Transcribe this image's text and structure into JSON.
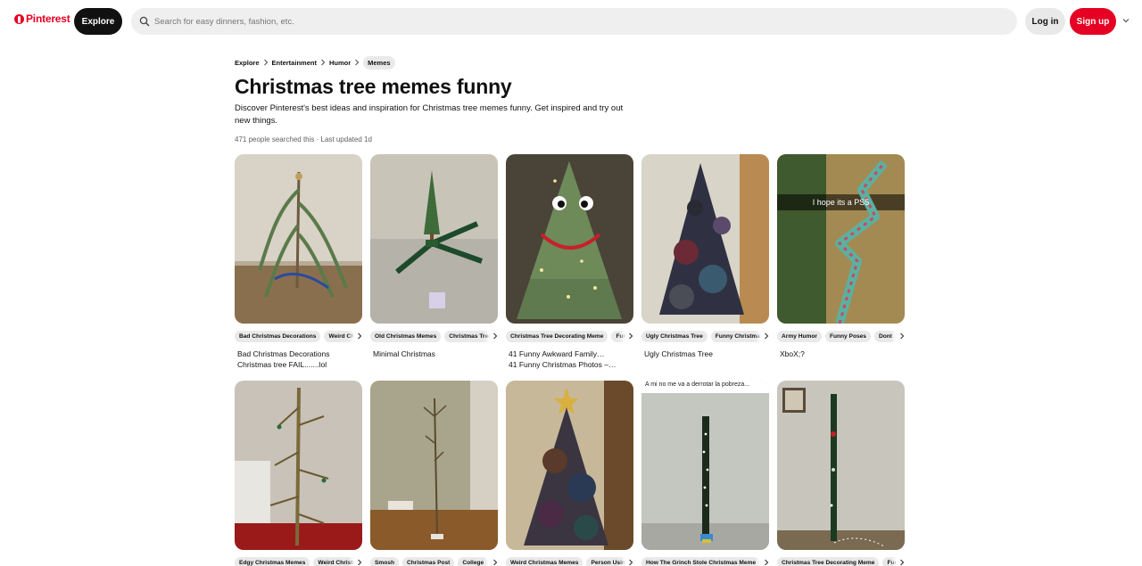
{
  "header": {
    "logo_text": "Pinterest",
    "explore_label": "Explore",
    "search_placeholder": "Search for easy dinners, fashion, etc.",
    "login_label": "Log in",
    "signup_label": "Sign up"
  },
  "breadcrumb": [
    "Explore",
    "Entertainment",
    "Humor",
    "Memes"
  ],
  "page": {
    "title": "Christmas tree memes funny",
    "description": "Discover Pinterest's best ideas and inspiration for Christmas tree memes funny. Get inspired and try out new things.",
    "searched": "471 people searched this · Last updated 1d"
  },
  "pins": [
    {
      "tags": [
        "Bad Christmas Decorations",
        "Weird Christmas"
      ],
      "title": "Bad Christmas Decorations",
      "subtitle": "Christmas tree FAIL.......lol"
    },
    {
      "tags": [
        "Old Christmas Memes",
        "Christmas Tree"
      ],
      "title": "Minimal Christmas",
      "subtitle": ""
    },
    {
      "tags": [
        "Christmas Tree Decorating Meme",
        "Funny"
      ],
      "title": "41 Funny Awkward Family…",
      "subtitle": "41 Funny Christmas Photos –…"
    },
    {
      "tags": [
        "Ugly Christmas Tree",
        "Funny Christmas"
      ],
      "title": "Ugly Christmas Tree",
      "subtitle": ""
    },
    {
      "tags": [
        "Army Humor",
        "Funny Poses",
        "Dont"
      ],
      "title": "XboX;?",
      "subtitle": "",
      "overlay_text": "I hope its a PS5"
    },
    {
      "tags": [
        "Edgy Christmas Memes",
        "Weird Christmas"
      ],
      "title": "",
      "subtitle": ""
    },
    {
      "tags": [
        "Smosh",
        "Christmas Post",
        "College"
      ],
      "title": "",
      "subtitle": ""
    },
    {
      "tags": [
        "Weird Christmas Memes",
        "Person Using"
      ],
      "title": "",
      "subtitle": ""
    },
    {
      "tags": [
        "How The Grinch Stole Christmas Meme"
      ],
      "title": "",
      "subtitle": "",
      "overlay_text": "A mi no me va a derrotar la pobreza..."
    },
    {
      "tags": [
        "Christmas Tree Decorating Meme",
        "Funny"
      ],
      "title": "",
      "subtitle": ""
    }
  ],
  "colors": {
    "brand": "#e60023",
    "chip": "#e9e9e9",
    "dark": "#111111"
  }
}
